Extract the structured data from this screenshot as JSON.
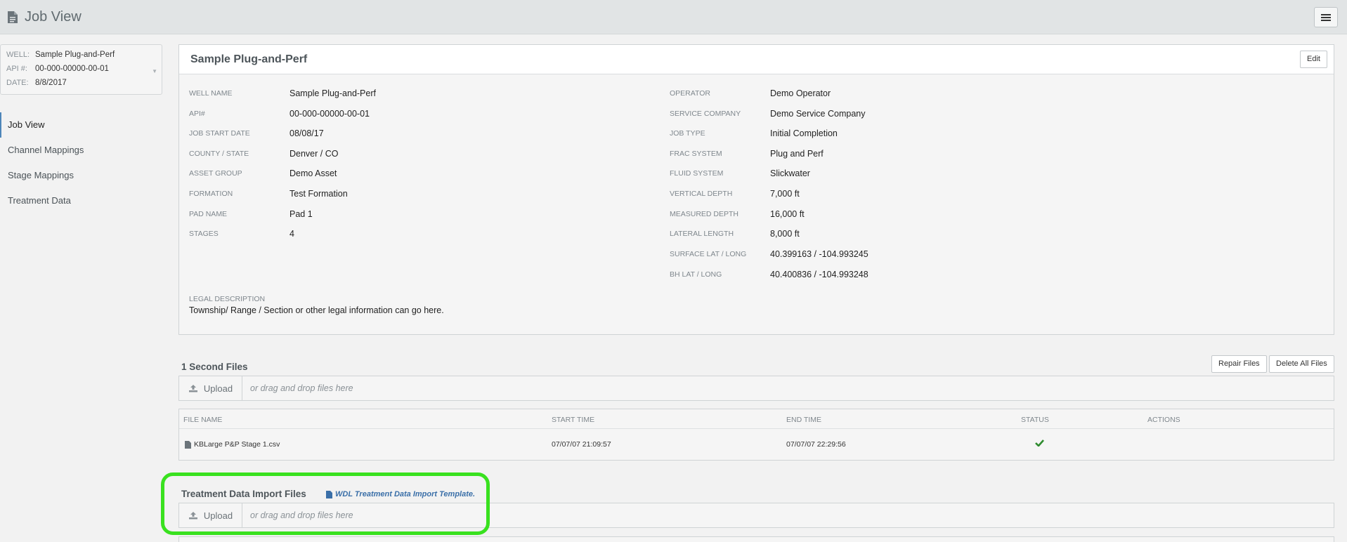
{
  "header": {
    "title": "Job View"
  },
  "well": {
    "well_label": "WELL:",
    "well_value": "Sample Plug-and-Perf",
    "api_label": "API #:",
    "api_value": "00-000-00000-00-01",
    "date_label": "DATE:",
    "date_value": "8/8/2017"
  },
  "sidebar": {
    "items": [
      {
        "label": "Job View"
      },
      {
        "label": "Channel Mappings"
      },
      {
        "label": "Stage Mappings"
      },
      {
        "label": "Treatment Data"
      }
    ]
  },
  "job": {
    "title": "Sample Plug-and-Perf",
    "edit_label": "Edit",
    "left_fields": [
      {
        "label": "WELL NAME",
        "value": "Sample Plug-and-Perf"
      },
      {
        "label": "API#",
        "value": "00-000-00000-00-01"
      },
      {
        "label": "JOB START DATE",
        "value": "08/08/17"
      },
      {
        "label": "COUNTY / STATE",
        "value": "Denver / CO"
      },
      {
        "label": "ASSET GROUP",
        "value": "Demo Asset"
      },
      {
        "label": "FORMATION",
        "value": "Test Formation"
      },
      {
        "label": "PAD NAME",
        "value": "Pad 1"
      },
      {
        "label": "STAGES",
        "value": "4"
      }
    ],
    "right_fields": [
      {
        "label": "OPERATOR",
        "value": "Demo Operator"
      },
      {
        "label": "SERVICE COMPANY",
        "value": "Demo Service Company"
      },
      {
        "label": "JOB TYPE",
        "value": "Initial Completion"
      },
      {
        "label": "FRAC SYSTEM",
        "value": "Plug and Perf"
      },
      {
        "label": "FLUID SYSTEM",
        "value": "Slickwater"
      },
      {
        "label": "VERTICAL DEPTH",
        "value": "7,000 ft"
      },
      {
        "label": "MEASURED DEPTH",
        "value": "16,000 ft"
      },
      {
        "label": "LATERAL LENGTH",
        "value": "8,000 ft"
      },
      {
        "label": "SURFACE LAT / LONG",
        "value": "40.399163 / -104.993245"
      },
      {
        "label": "BH LAT / LONG",
        "value": "40.400836 / -104.993248"
      }
    ],
    "legal_label": "LEGAL DESCRIPTION",
    "legal_value": "Township/ Range / Section or other legal information can go here."
  },
  "second_files": {
    "title": "1 Second Files",
    "repair_label": "Repair Files",
    "delete_label": "Delete All Files",
    "upload_label": "Upload",
    "drop_placeholder": "or drag and drop files here",
    "columns": [
      "FILE NAME",
      "START TIME",
      "END TIME",
      "STATUS",
      "ACTIONS"
    ],
    "rows": [
      {
        "file_name": "KBLarge P&P Stage 1.csv",
        "start": "07/07/07 21:09:57",
        "end": "07/07/07 22:29:56",
        "status": "ok"
      }
    ]
  },
  "treatment_files": {
    "title": "Treatment Data Import Files",
    "template_link": "WDL Treatment Data Import Template.",
    "upload_label": "Upload",
    "drop_placeholder": "or drag and drop files here"
  },
  "colors": {
    "highlight": "#39e11f",
    "link": "#3a6fa8",
    "status_ok": "#2e8b2e",
    "active_nav": "#4e86b9"
  }
}
